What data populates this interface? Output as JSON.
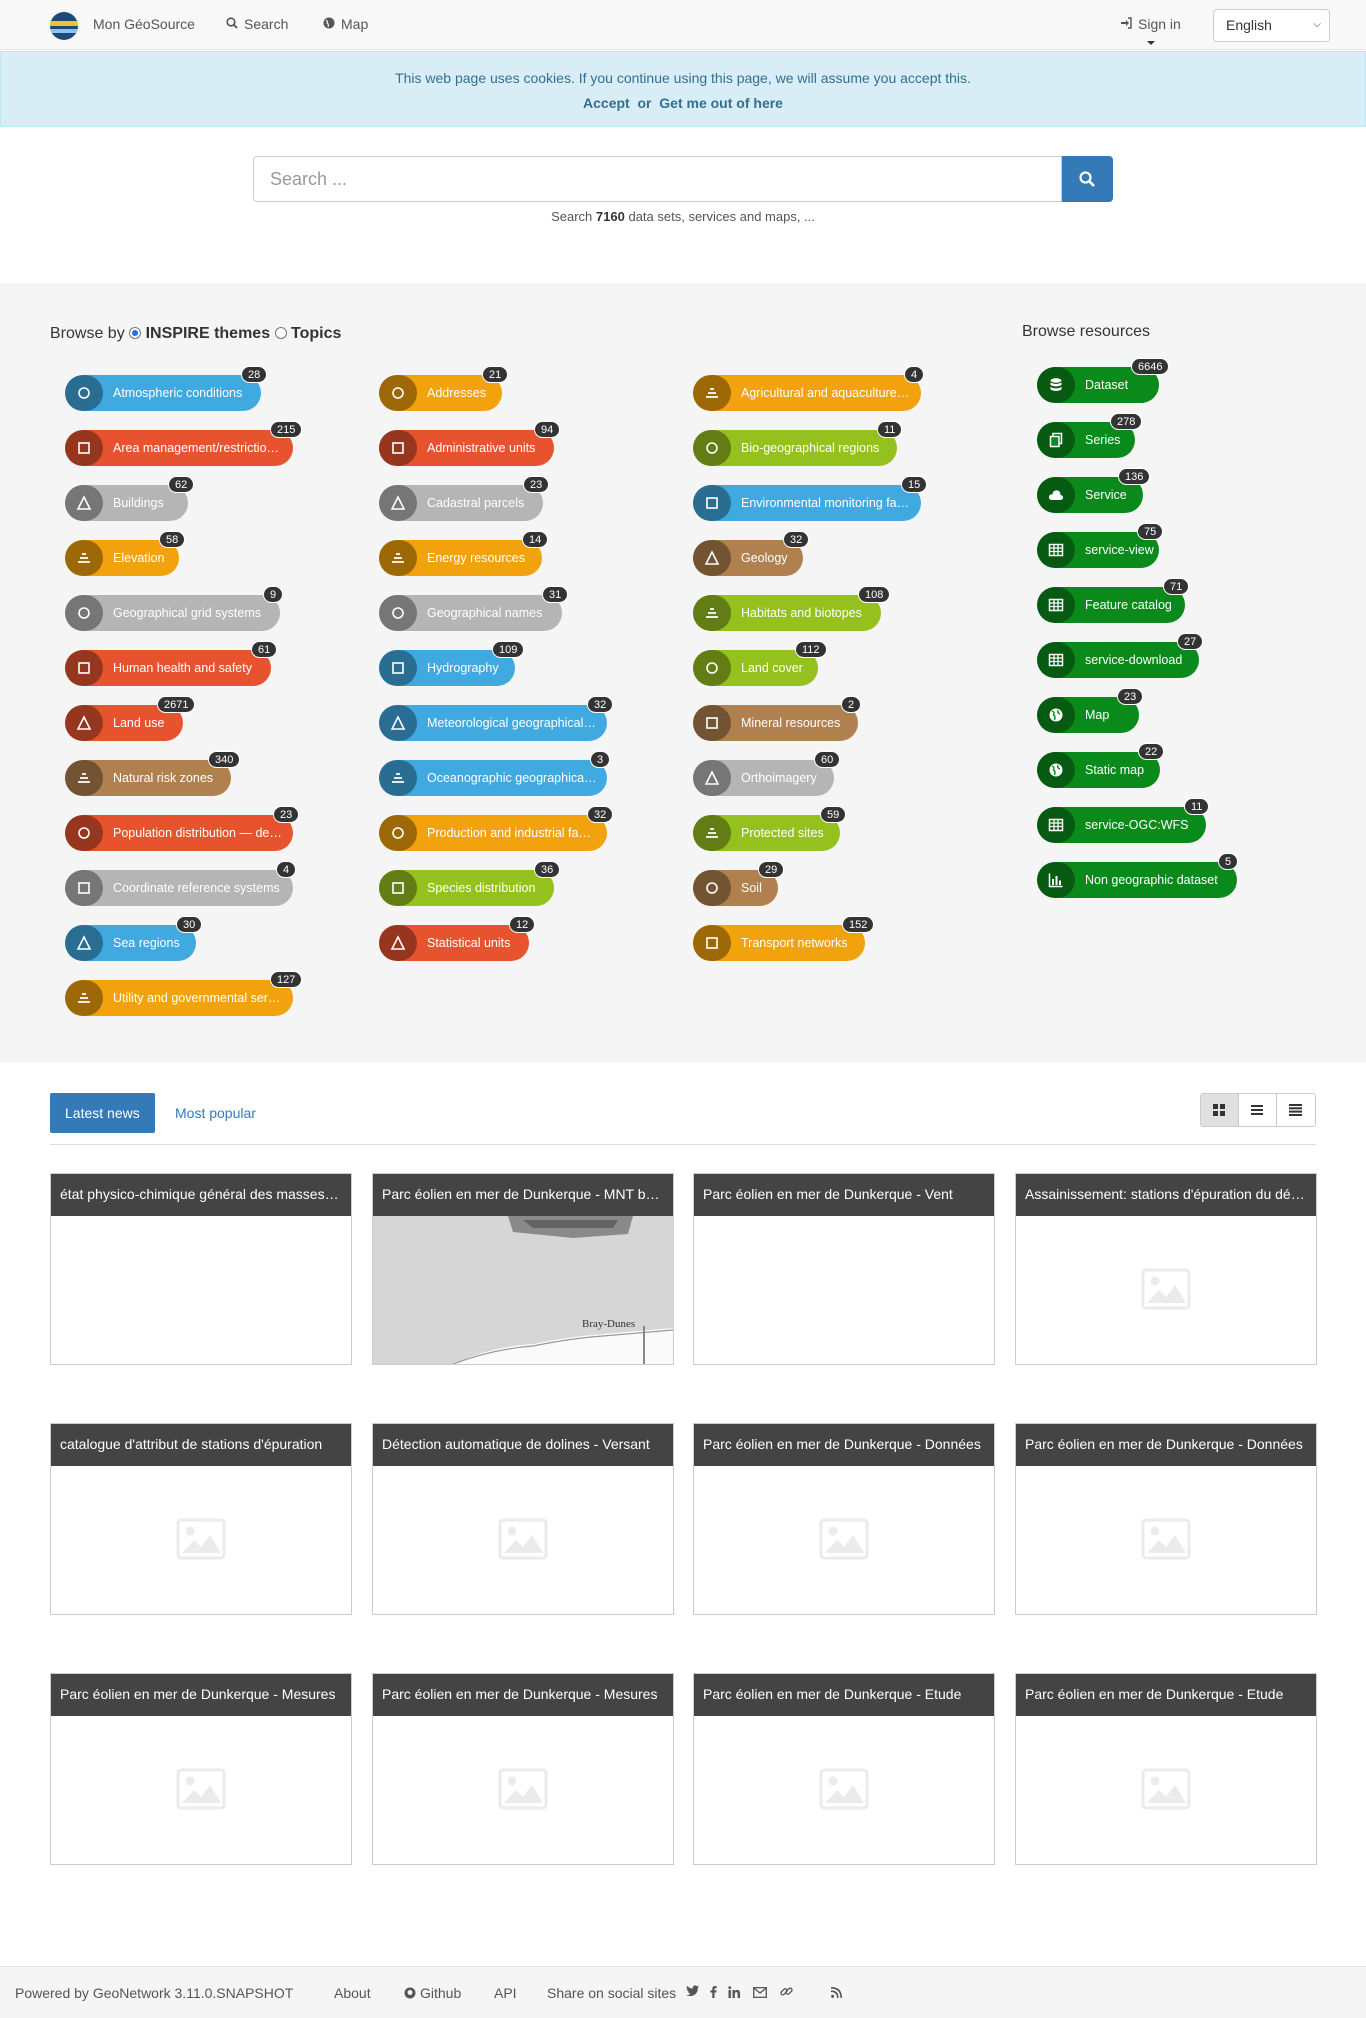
{
  "nav": {
    "brand": "Mon GéoSource",
    "search": "Search",
    "map": "Map",
    "signin": "Sign in",
    "language": "English"
  },
  "cookie": {
    "message": "This web page uses cookies. If you continue using this page, we will assume you accept this.",
    "accept": "Accept",
    "or": "or",
    "leave": "Get me out of here"
  },
  "search": {
    "placeholder": "Search ...",
    "hint_prefix": "Search",
    "count": "7160",
    "hint_suffix": "data sets, services and maps, ..."
  },
  "browse": {
    "label": "Browse by",
    "option_inspire": "INSPIRE themes",
    "option_topics": "Topics",
    "resources_title": "Browse resources",
    "themes": [
      {
        "label": "Atmospheric conditions",
        "count": "28",
        "color": "#3fa9e0"
      },
      {
        "label": "Area management/restriction/regulation zones and reporting units",
        "count": "215",
        "color": "#e8532f"
      },
      {
        "label": "Buildings",
        "count": "62",
        "color": "#b5b5b5"
      },
      {
        "label": "Elevation",
        "count": "58",
        "color": "#f2a20c"
      },
      {
        "label": "Geographical grid systems",
        "count": "9",
        "color": "#b5b5b5"
      },
      {
        "label": "Human health and safety",
        "count": "61",
        "color": "#e8532f"
      },
      {
        "label": "Land use",
        "count": "2671",
        "color": "#e8532f"
      },
      {
        "label": "Natural risk zones",
        "count": "340",
        "color": "#b0814f"
      },
      {
        "label": "Population distribution — demography",
        "count": "23",
        "color": "#e8532f"
      },
      {
        "label": "Coordinate reference systems",
        "count": "4",
        "color": "#b5b5b5"
      },
      {
        "label": "Sea regions",
        "count": "30",
        "color": "#3fa9e0"
      },
      {
        "label": "Utility and governmental services",
        "count": "127",
        "color": "#f2a20c"
      },
      {
        "label": "Addresses",
        "count": "21",
        "color": "#f2a20c"
      },
      {
        "label": "Administrative units",
        "count": "94",
        "color": "#e8532f"
      },
      {
        "label": "Cadastral parcels",
        "count": "23",
        "color": "#b5b5b5"
      },
      {
        "label": "Energy resources",
        "count": "14",
        "color": "#f2a20c"
      },
      {
        "label": "Geographical names",
        "count": "31",
        "color": "#b5b5b5"
      },
      {
        "label": "Hydrography",
        "count": "109",
        "color": "#3fa9e0"
      },
      {
        "label": "Meteorological geographical features",
        "count": "32",
        "color": "#3fa9e0"
      },
      {
        "label": "Oceanographic geographical features",
        "count": "3",
        "color": "#3fa9e0"
      },
      {
        "label": "Production and industrial facilities",
        "count": "32",
        "color": "#f2a20c"
      },
      {
        "label": "Species distribution",
        "count": "36",
        "color": "#95c11f"
      },
      {
        "label": "Statistical units",
        "count": "12",
        "color": "#e8532f"
      },
      {
        "label": "Agricultural and aquaculture facilities",
        "count": "4",
        "color": "#f2a20c"
      },
      {
        "label": "Bio-geographical regions",
        "count": "11",
        "color": "#95c11f"
      },
      {
        "label": "Environmental monitoring facilities",
        "count": "15",
        "color": "#3fa9e0"
      },
      {
        "label": "Geology",
        "count": "32",
        "color": "#b0814f"
      },
      {
        "label": "Habitats and biotopes",
        "count": "108",
        "color": "#95c11f"
      },
      {
        "label": "Land cover",
        "count": "112",
        "color": "#95c11f"
      },
      {
        "label": "Mineral resources",
        "count": "2",
        "color": "#b0814f"
      },
      {
        "label": "Orthoimagery",
        "count": "60",
        "color": "#b5b5b5"
      },
      {
        "label": "Protected sites",
        "count": "59",
        "color": "#95c11f"
      },
      {
        "label": "Soil",
        "count": "29",
        "color": "#b0814f"
      },
      {
        "label": "Transport networks",
        "count": "152",
        "color": "#f2a20c"
      }
    ],
    "resources": [
      {
        "label": "Dataset",
        "count": "6646",
        "icon": "database-icon"
      },
      {
        "label": "Series",
        "count": "278",
        "icon": "files-icon"
      },
      {
        "label": "Service",
        "count": "136",
        "icon": "cloud-icon"
      },
      {
        "label": "service-view",
        "count": "75",
        "icon": "table-icon"
      },
      {
        "label": "Feature catalog",
        "count": "71",
        "icon": "table-icon"
      },
      {
        "label": "service-download",
        "count": "27",
        "icon": "table-icon"
      },
      {
        "label": "Map",
        "count": "23",
        "icon": "globe-icon"
      },
      {
        "label": "Static map",
        "count": "22",
        "icon": "globe-icon"
      },
      {
        "label": "service-OGC:WFS",
        "count": "11",
        "icon": "table-icon"
      },
      {
        "label": "Non geographic dataset",
        "count": "5",
        "icon": "bar-chart-icon"
      }
    ]
  },
  "news": {
    "tab_latest": "Latest news",
    "tab_popular": "Most popular",
    "cards": [
      {
        "title": "état physico-chimique général des masses d'eau",
        "thumb": "empty"
      },
      {
        "title": "Parc éolien en mer de Dunkerque - MNT bathymétrie",
        "thumb": "map",
        "map_label": "Bray-Dunes"
      },
      {
        "title": "Parc éolien en mer de Dunkerque - Vent",
        "thumb": "empty"
      },
      {
        "title": "Assainissement: stations d'épuration du département",
        "thumb": "placeholder"
      },
      {
        "title": "catalogue d'attribut de stations d'épuration",
        "thumb": "placeholder"
      },
      {
        "title": "Détection automatique de dolines - Versant",
        "thumb": "placeholder"
      },
      {
        "title": "Parc éolien en mer de Dunkerque - Données",
        "thumb": "placeholder"
      },
      {
        "title": "Parc éolien en mer de Dunkerque - Données",
        "thumb": "placeholder"
      },
      {
        "title": "Parc éolien en mer de Dunkerque - Mesures",
        "thumb": "placeholder"
      },
      {
        "title": "Parc éolien en mer de Dunkerque - Mesures",
        "thumb": "placeholder"
      },
      {
        "title": "Parc éolien en mer de Dunkerque - Etude",
        "thumb": "placeholder"
      },
      {
        "title": "Parc éolien en mer de Dunkerque - Etude",
        "thumb": "placeholder"
      }
    ]
  },
  "footer": {
    "powered": "Powered by GeoNetwork 3.11.0.SNAPSHOT",
    "about": "About",
    "github": "Github",
    "api": "API",
    "share": "Share on social sites"
  }
}
